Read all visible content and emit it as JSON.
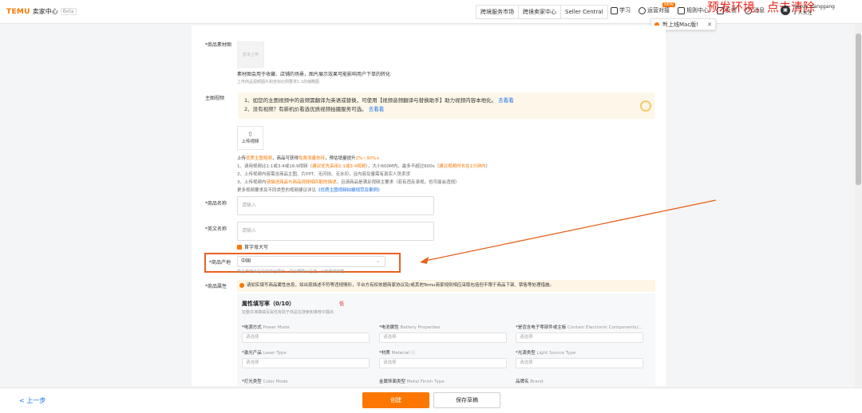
{
  "topbar": {
    "logo_brand": "TEMU",
    "logo_title": "卖家中心",
    "logo_beta": "Beta",
    "links": [
      "跨境服务市场",
      "跨境卖家中心",
      "Seller Central"
    ],
    "icons": [
      {
        "label": "学习",
        "icon": "book-icon"
      },
      {
        "label": "运营对接",
        "icon": "chat-icon",
        "badge": "NEW"
      },
      {
        "label": "规则中心",
        "icon": "rules-icon"
      },
      {
        "label": "反馈",
        "icon": "feedback-icon"
      },
      {
        "label": "消息",
        "icon": "bell-icon"
      }
    ],
    "env_notice": "预发环境，点击清除",
    "user_name": "hexue xianggang",
    "user_sub": "1 人关注",
    "tooltip": "新上线Mac版!"
  },
  "form": {
    "material_label": "*商品素材图",
    "material_placeholder": "暂未上传",
    "material_help": "素材图会用于收藏、店铺的场景，图片展示效果可能影响用户下单的转化",
    "material_help2": "上传商品视频图片和坐标比例要求1:1的缩略图",
    "video_label": "主图视频",
    "video_notice_1": "1、如您的主图视频中的音频需翻译为英语或替换，可使用【视频音频翻译与替换助手】助力视频内容本地化。",
    "video_notice_1_link": "去看看",
    "video_notice_2": "2、没有视频？有新机价看选优质视频拍摄服务可选。",
    "video_notice_2_link": "去看看",
    "upload_label": "上传视频",
    "video_help_1a": "上传",
    "video_help_1b": "优质主图视频",
    "video_help_1c": "，商品可获得",
    "video_help_1d": "免费流量扶持",
    "video_help_1e": "，预估销量提升",
    "video_help_1f": "2%~30%+",
    "video_help_2a": "1、请用视频比1:1或3:4或16:9视频（",
    "video_help_2b": "建议优先采用1:1或3:4视频",
    "video_help_2c": "），大小600M内，最多不超过600s（",
    "video_help_2d": "建议视频时长在1分钟内",
    "video_help_2e": "）",
    "video_help_3a": "2、上传视频内容需含商品主图、片PPT、无闪烁、无水印，且内容及量需有真实人员卖货",
    "video_help_4a": "3、上传视频内",
    "video_help_4b": "请描述商品与商品视频相匹配的描述",
    "video_help_4c": "，且请商品是满足视频主要求（若有违反承规，也可能会违规）",
    "video_help_5a": "更多视频要求及不同类型的视频建议详见",
    "video_help_5b": "《优质主图视频拍摄规范及案例》",
    "name_label": "*商品名称",
    "name_placeholder": "请输入",
    "en_name_label": "*英文名称",
    "en_name_placeholder": "请输入",
    "capitalize_label": "首字母大写",
    "origin_label": "*商品产地",
    "origin_value": "中国",
    "origin_help": "商品产地会在站内前台展示，请仔细确认后选，以免影响销售",
    "attr_label": "*商品属性",
    "attr_notice": "请如实填写商品属性信息，如出现描述不符等违规情形，平台方有权依据商家协议及/或其他Temu商家规则相应采取包括但不限于商品下架、禁售等处理措施。",
    "attr_panel_title": "属性填写率（0/10）",
    "attr_panel_sub": "完整并准确填写属性有助于商品在搜索和推荐中露出",
    "attr_panel_red": "低",
    "attrs": [
      {
        "label": "*电源方式",
        "en": "Power Mode",
        "placeholder": "请选择"
      },
      {
        "label": "*电池属性",
        "en": "Battery Properties",
        "placeholder": "请选择"
      },
      {
        "label": "*是否含电子零部件或主板",
        "en": "Contain Electronic Components/...",
        "placeholder": "请选择"
      },
      {
        "label": "*激光产品",
        "en": "Laser Type",
        "placeholder": "请选择"
      },
      {
        "label": "*材质",
        "en": "Material ⓘ",
        "placeholder": "请选择"
      },
      {
        "label": "*光源类型",
        "en": "Light Source Type",
        "placeholder": "请选择"
      },
      {
        "label": "*灯光类型",
        "en": "Color Mode",
        "placeholder": ""
      },
      {
        "label": "金属饰面类型",
        "en": "Metal Finish Type",
        "placeholder": ""
      },
      {
        "label": "品牌名",
        "en": "Brand",
        "placeholder": ""
      }
    ]
  },
  "bottom": {
    "back": "< 上一步",
    "create": "创建",
    "draft": "保存草稿"
  },
  "colors": {
    "accent": "#fb7701",
    "env_red": "#e8261d",
    "annotation": "#e8621d",
    "link": "#1a6ee8"
  }
}
